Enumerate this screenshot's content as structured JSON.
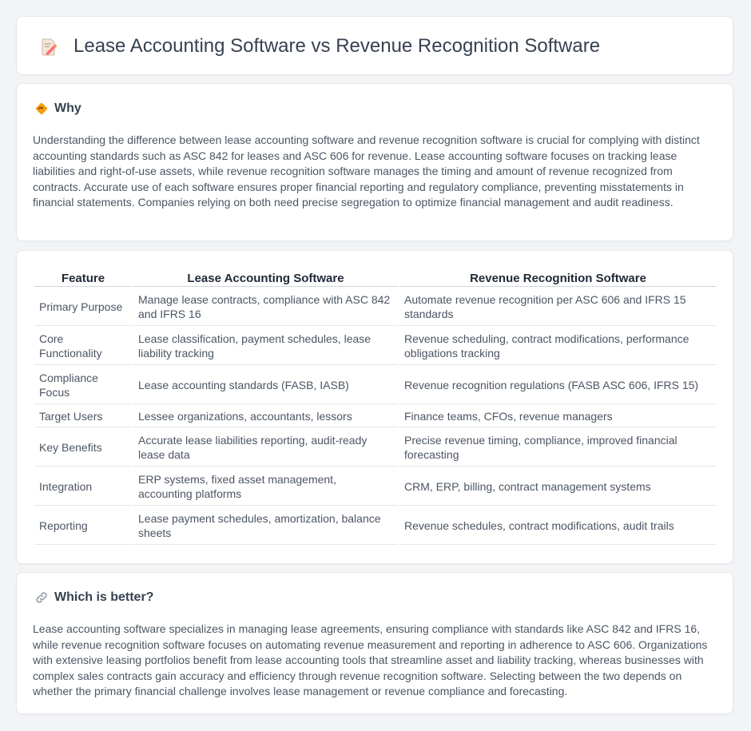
{
  "header": {
    "title": "Lease Accounting Software vs Revenue Recognition Software",
    "icon": "document-edit-icon"
  },
  "why": {
    "heading": "Why",
    "icon": "diamond-sign-icon",
    "text": "Understanding the difference between lease accounting software and revenue recognition software is crucial for complying with distinct accounting standards such as ASC 842 for leases and ASC 606 for revenue. Lease accounting software focuses on tracking lease liabilities and right-of-use assets, while revenue recognition software manages the timing and amount of revenue recognized from contracts. Accurate use of each software ensures proper financial reporting and regulatory compliance, preventing misstatements in financial statements. Companies relying on both need precise segregation to optimize financial management and audit readiness."
  },
  "table": {
    "headers": [
      "Feature",
      "Lease Accounting Software",
      "Revenue Recognition Software"
    ],
    "rows": [
      [
        "Primary Purpose",
        "Manage lease contracts, compliance with ASC 842 and IFRS 16",
        "Automate revenue recognition per ASC 606 and IFRS 15 standards"
      ],
      [
        "Core Functionality",
        "Lease classification, payment schedules, lease liability tracking",
        "Revenue scheduling, contract modifications, performance obligations tracking"
      ],
      [
        "Compliance Focus",
        "Lease accounting standards (FASB, IASB)",
        "Revenue recognition regulations (FASB ASC 606, IFRS 15)"
      ],
      [
        "Target Users",
        "Lessee organizations, accountants, lessors",
        "Finance teams, CFOs, revenue managers"
      ],
      [
        "Key Benefits",
        "Accurate lease liabilities reporting, audit-ready lease data",
        "Precise revenue timing, compliance, improved financial forecasting"
      ],
      [
        "Integration",
        "ERP systems, fixed asset management, accounting platforms",
        "CRM, ERP, billing, contract management systems"
      ],
      [
        "Reporting",
        "Lease payment schedules, amortization, balance sheets",
        "Revenue schedules, contract modifications, audit trails"
      ]
    ]
  },
  "better": {
    "heading": "Which is better?",
    "icon": "link-icon",
    "text": "Lease accounting software specializes in managing lease agreements, ensuring compliance with standards like ASC 842 and IFRS 16, while revenue recognition software focuses on automating revenue measurement and reporting in adherence to ASC 606. Organizations with extensive leasing portfolios benefit from lease accounting tools that streamline asset and liability tracking, whereas businesses with complex sales contracts gain accuracy and efficiency through revenue recognition software. Selecting between the two depends on whether the primary financial challenge involves lease management or revenue compliance and forecasting."
  }
}
